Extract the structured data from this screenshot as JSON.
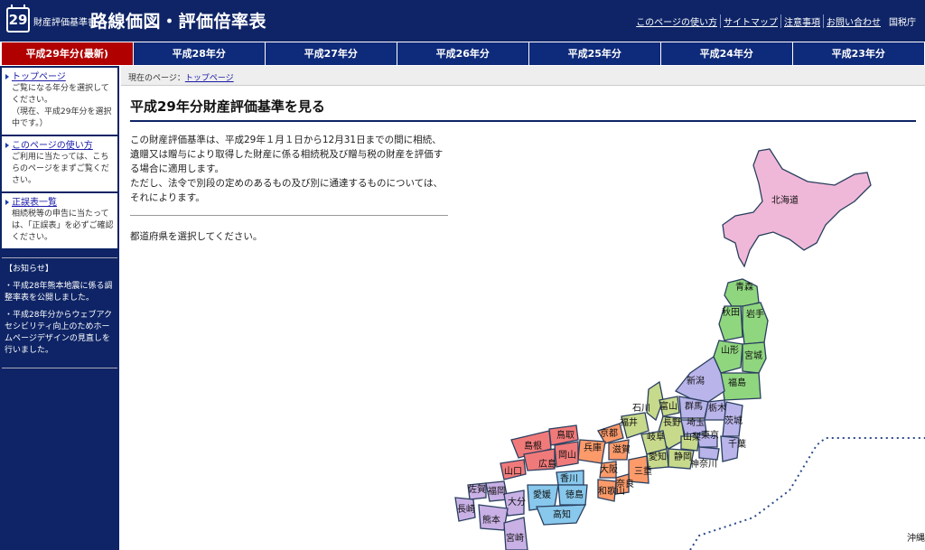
{
  "header": {
    "logo_number": "29",
    "sub_title": "財産評価基準書",
    "title": "路線価図・評価倍率表",
    "links": [
      "このページの使い方",
      "サイトマップ",
      "注意事項",
      "お問い合わせ"
    ],
    "agency": "国税庁"
  },
  "tabs": [
    {
      "label": "平成29年分(最新)",
      "active": true
    },
    {
      "label": "平成28年分"
    },
    {
      "label": "平成27年分"
    },
    {
      "label": "平成26年分"
    },
    {
      "label": "平成25年分"
    },
    {
      "label": "平成24年分"
    },
    {
      "label": "平成23年分"
    }
  ],
  "sidebar": {
    "items": [
      {
        "link": "トップページ",
        "text": "ご覧になる年分を選択してください。",
        "note": "（現在、平成29年分を選択中です。）"
      },
      {
        "link": "このページの使い方",
        "text": "ご利用に当たっては、こちらのページをまずご覧ください。"
      },
      {
        "link": "正誤表一覧",
        "text": "相続税等の申告に当たっては、「正誤表」を必ずご確認ください。"
      }
    ],
    "notice_title": "【お知らせ】",
    "notices": [
      "・平成28年熊本地震に係る調整率表を公開しました。",
      "・平成28年分からウェブアクセシビリティ向上のためホームページデザインの見直しを行いました。"
    ]
  },
  "breadcrumb": {
    "prefix": "現在のページ：",
    "link": "トップページ"
  },
  "main": {
    "title": "平成29年分財産評価基準を見る",
    "intro1": "この財産評価基準は、平成29年１月１日から12月31日までの間に相続、遺贈又は贈与により取得した財産に係る相続税及び贈与税の財産を評価する場合に適用します。",
    "intro2": "ただし、法令で別段の定めのあるもの及び別に通達するものについては、それによります。",
    "select": "都道府県を選択してください。"
  },
  "map": {
    "prefectures": [
      "北海道",
      "青森",
      "秋田",
      "岩手",
      "山形",
      "宮城",
      "新潟",
      "福島",
      "石川",
      "富山",
      "群馬",
      "栃木",
      "福井",
      "長野",
      "埼玉",
      "茨城",
      "岐阜",
      "山梨",
      "東京",
      "千葉",
      "島根",
      "鳥取",
      "京都",
      "兵庫",
      "滋賀",
      "愛知",
      "静岡",
      "神奈川",
      "山口",
      "広島",
      "岡山",
      "大阪",
      "三重",
      "香川",
      "奈良",
      "佐賀",
      "福岡",
      "愛媛",
      "徳島",
      "和歌山",
      "長崎",
      "大分",
      "高知",
      "熊本",
      "宮崎",
      "沖縄"
    ]
  }
}
